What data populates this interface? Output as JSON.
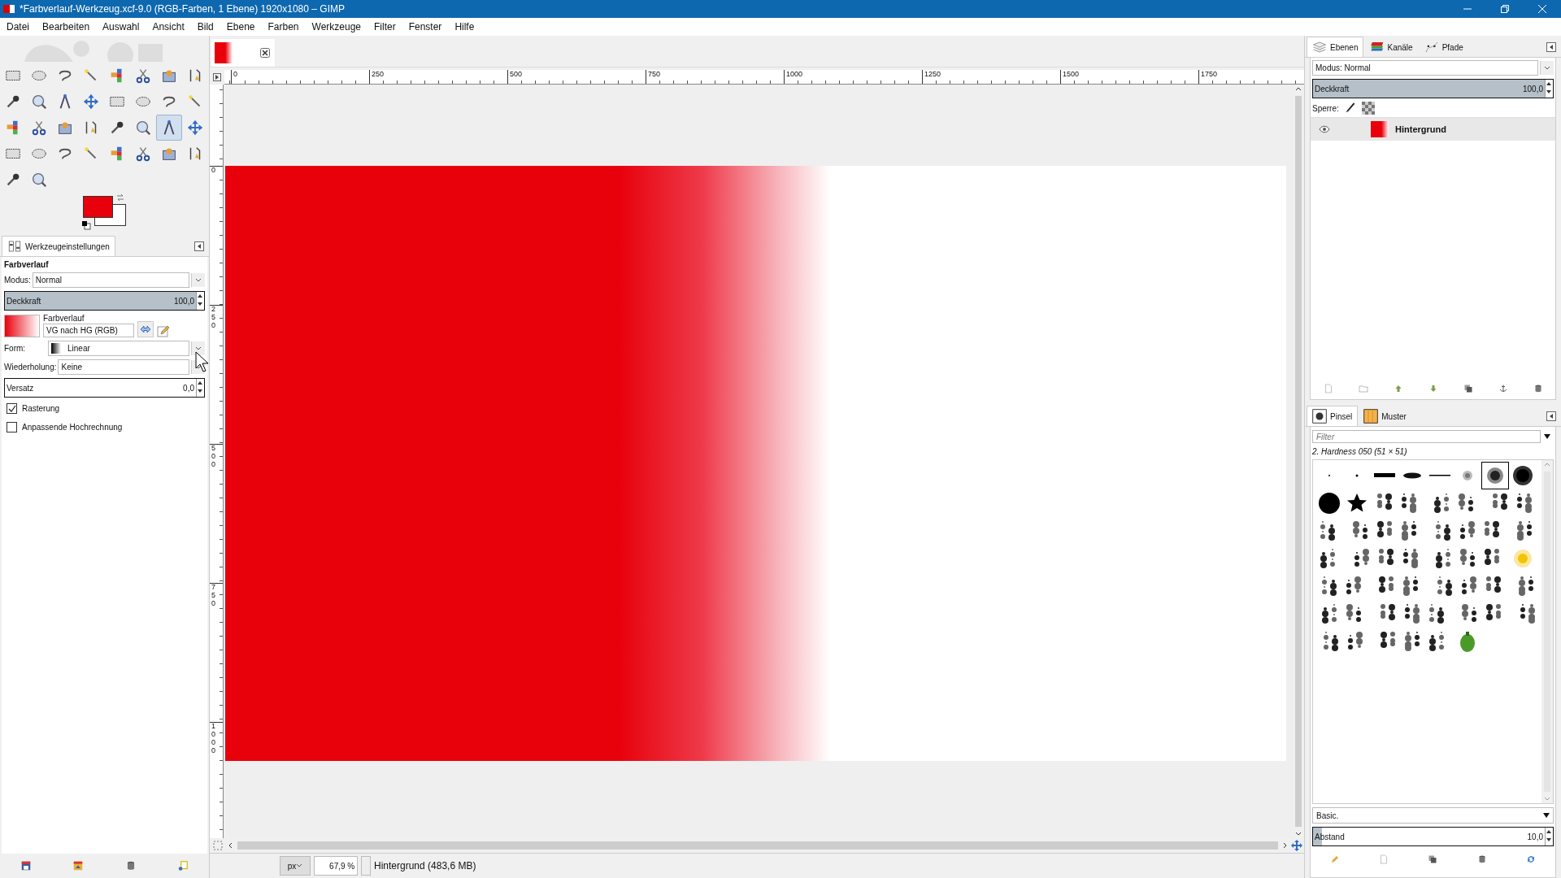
{
  "window": {
    "title": "*Farbverlauf-Werkzeug.xcf-9.0 (RGB-Farben, 1 Ebene) 1920x1080 – GIMP"
  },
  "menu": [
    "Datei",
    "Bearbeiten",
    "Auswahl",
    "Ansicht",
    "Bild",
    "Ebene",
    "Farben",
    "Werkzeuge",
    "Filter",
    "Fenster",
    "Hilfe"
  ],
  "tools": [
    {
      "selected": false
    },
    {
      "selected": false
    },
    {
      "selected": false
    },
    {
      "selected": false
    },
    {
      "selected": false
    },
    {
      "selected": false
    },
    {
      "selected": false
    },
    {
      "selected": false
    },
    {
      "selected": false
    },
    {
      "selected": false
    },
    {
      "selected": false
    },
    {
      "selected": false
    },
    {
      "selected": false
    },
    {
      "selected": false
    },
    {
      "selected": false
    },
    {
      "selected": false
    },
    {
      "selected": false
    },
    {
      "selected": false
    },
    {
      "selected": false
    },
    {
      "selected": false
    },
    {
      "selected": false
    },
    {
      "selected": false
    },
    {
      "selected": true
    },
    {
      "selected": false
    },
    {
      "selected": false
    },
    {
      "selected": false
    },
    {
      "selected": false
    },
    {
      "selected": false
    },
    {
      "selected": false
    },
    {
      "selected": false
    },
    {
      "selected": false
    },
    {
      "selected": false
    },
    {
      "selected": false
    },
    {
      "selected": false
    }
  ],
  "tool_options": {
    "tab": "Werkzeugeinstellungen",
    "heading": "Farbverlauf",
    "mode_label": "Modus:",
    "mode": "Normal",
    "opacity": {
      "label": "Deckkraft",
      "reading": "100,0",
      "level": 1
    },
    "gradient_label": "Farbverlauf",
    "gradient": "VG nach HG (RGB)",
    "form_label": "Form:",
    "form": "Linear",
    "repeat_label": "Wiederholung:",
    "repeat": "Keine",
    "offset": {
      "label": "Versatz",
      "reading": "0,0",
      "level": 0
    },
    "checkboxes": [
      {
        "label": "Rasterung",
        "checked": true
      },
      {
        "label": "Anpassende Hochrechnung",
        "checked": false
      }
    ]
  },
  "rulers": {
    "horizontal": [
      "0",
      "250",
      "500",
      "750",
      "1000",
      "1250",
      "1500",
      "1750"
    ],
    "vertical": [
      "0",
      "250",
      "500",
      "750",
      "1000"
    ]
  },
  "status": {
    "unit": "px",
    "zoom": "67,9 %",
    "info": "Hintergrund (483,6 MB)"
  },
  "layers_panel": {
    "tabs": [
      {
        "label": "Ebenen",
        "selected": true
      },
      {
        "label": "Kanäle",
        "selected": false
      },
      {
        "label": "Pfade",
        "selected": false
      }
    ],
    "mode": "Modus: Normal",
    "opacity": {
      "label": "Deckkraft",
      "reading": "100,0",
      "level": 1
    },
    "lock_label": "Sperre:",
    "layers": [
      {
        "name": "Hintergrund",
        "visible": true,
        "selected": true
      }
    ]
  },
  "brushes_panel": {
    "tabs": [
      {
        "label": "Pinsel",
        "selected": true
      },
      {
        "label": "Muster",
        "selected": false
      }
    ],
    "filter_placeholder": "Filter",
    "brush_name": "2. Hardness 050 (51 × 51)",
    "brushes": [
      {
        "selected": false
      },
      {
        "selected": false
      },
      {
        "selected": false
      },
      {
        "selected": false
      },
      {
        "selected": false
      },
      {
        "selected": false
      },
      {
        "selected": true
      },
      {
        "selected": false
      },
      {
        "selected": false
      },
      {
        "selected": false
      },
      {
        "selected": false
      },
      {
        "selected": false
      },
      {
        "selected": false
      },
      {
        "selected": false
      },
      {
        "selected": false
      },
      {
        "selected": false
      },
      {
        "selected": false
      },
      {
        "selected": false
      },
      {
        "selected": false
      },
      {
        "selected": false
      },
      {
        "selected": false
      },
      {
        "selected": false
      },
      {
        "selected": false
      },
      {
        "selected": false
      },
      {
        "selected": false
      },
      {
        "selected": false
      },
      {
        "selected": false
      },
      {
        "selected": false
      },
      {
        "selected": false
      },
      {
        "selected": false
      },
      {
        "selected": false
      },
      {
        "selected": false
      },
      {
        "selected": false
      },
      {
        "selected": false
      },
      {
        "selected": false
      },
      {
        "selected": false
      },
      {
        "selected": false
      },
      {
        "selected": false
      },
      {
        "selected": false
      },
      {
        "selected": false
      },
      {
        "selected": false
      },
      {
        "selected": false
      },
      {
        "selected": false
      },
      {
        "selected": false
      },
      {
        "selected": false
      },
      {
        "selected": false
      },
      {
        "selected": false
      },
      {
        "selected": false
      },
      {
        "selected": false
      },
      {
        "selected": false
      },
      {
        "selected": false
      },
      {
        "selected": false
      },
      {
        "selected": false
      },
      {
        "selected": false
      }
    ],
    "preset": "Basic.",
    "spacing": {
      "label": "Abstand",
      "reading": "10,0",
      "level": 0.04
    }
  }
}
